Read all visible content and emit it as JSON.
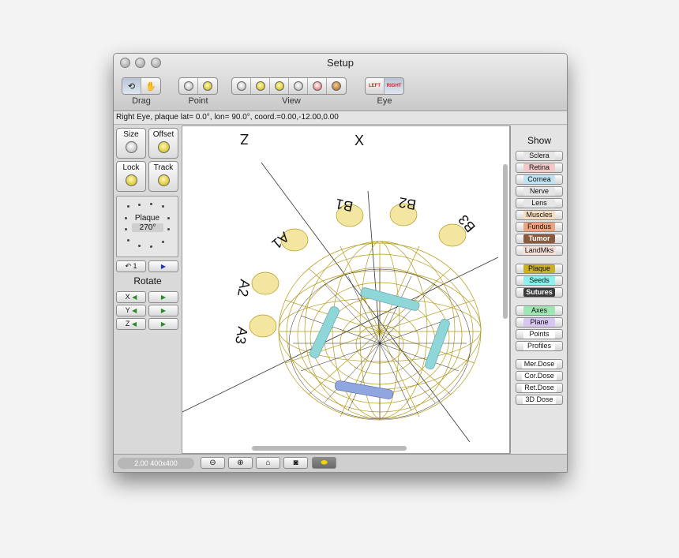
{
  "window": {
    "title": "Setup"
  },
  "toolbar": {
    "groups": [
      {
        "label": "Drag"
      },
      {
        "label": "Point"
      },
      {
        "label": "View"
      },
      {
        "label": "Eye"
      }
    ],
    "eye_left": "LEFT",
    "eye_right": "RIGHT"
  },
  "status": {
    "text": "Right Eye, plaque lat=  0.0°, lon= 90.0°, coord.=0.00,-12.00,0.00"
  },
  "left": {
    "size_label": "Size",
    "offset_label": "Offset",
    "lock_label": "Lock",
    "track_label": "Track",
    "plaque_label": "Plaque",
    "plaque_angle": "270°",
    "rotate_label": "Rotate",
    "rot_x": "X",
    "rot_y": "Y",
    "rot_z": "Z",
    "undo_value": "1"
  },
  "view3d": {
    "axis_z": "Z",
    "axis_x": "X",
    "labels": [
      "B1",
      "B2",
      "B3",
      "A1",
      "A2",
      "A3"
    ]
  },
  "show": {
    "title": "Show",
    "items": [
      {
        "label": "Sclera",
        "color": "#e6e6e6"
      },
      {
        "label": "Retina",
        "color": "#f2c9c9"
      },
      {
        "label": "Cornea",
        "color": "#bfe3f5"
      },
      {
        "label": "Nerve",
        "color": "#e6e6e6"
      },
      {
        "label": "Lens",
        "color": "#e6e6e6"
      },
      {
        "label": "Muscles",
        "color": "#f6dcc0"
      },
      {
        "label": "Fundus",
        "color": "#e9a580"
      },
      {
        "label": "Tumor",
        "color": "#8b5a3c"
      },
      {
        "label": "LandMks",
        "color": "#f5dfda"
      },
      {
        "label": "Plaque",
        "color": "#c9b21e"
      },
      {
        "label": "Seeds",
        "color": "#8cf2ee"
      },
      {
        "label": "Sutures",
        "color": "#3a3a3a"
      },
      {
        "label": "Axes",
        "color": "#9ee6b4"
      },
      {
        "label": "Plane",
        "color": "#d8c6f2"
      },
      {
        "label": "Points",
        "color": "#ffffff"
      },
      {
        "label": "Profiles",
        "color": "#ffffff"
      },
      {
        "label": "Mer.Dose",
        "color": "#ffffff"
      },
      {
        "label": "Cor.Dose",
        "color": "#ffffff"
      },
      {
        "label": "Ret.Dose",
        "color": "#ffffff"
      },
      {
        "label": "3D Dose",
        "color": "#ffffff"
      }
    ]
  },
  "bottom": {
    "zoom_text": "2.00 400x400"
  }
}
